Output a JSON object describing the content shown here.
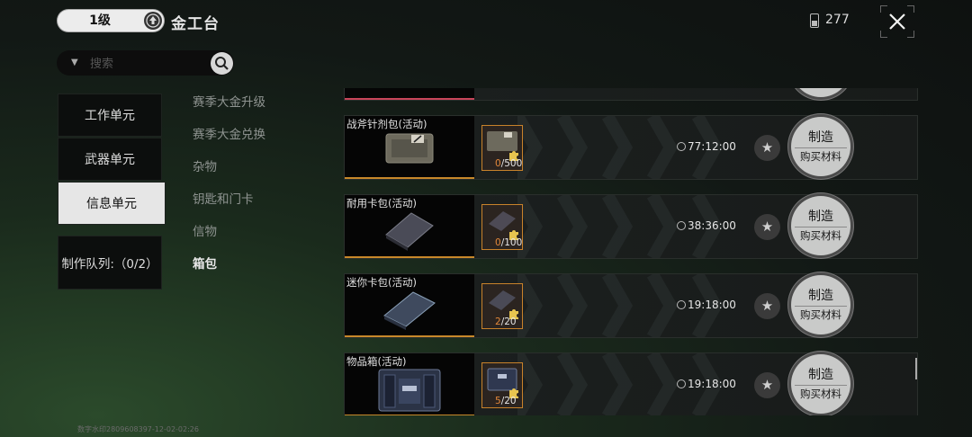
{
  "header": {
    "level": "1级",
    "title": "金工台",
    "currency_amount": "277"
  },
  "search": {
    "placeholder": "搜索"
  },
  "sidebar": {
    "items": [
      {
        "label": "工作单元",
        "active": false
      },
      {
        "label": "武器单元",
        "active": false
      },
      {
        "label": "信息单元",
        "active": true
      }
    ],
    "queue_label": "制作队列:（0/2）"
  },
  "categories": [
    {
      "label": "赛季大金升级",
      "active": false
    },
    {
      "label": "赛季大金兑换",
      "active": false
    },
    {
      "label": "杂物",
      "active": false
    },
    {
      "label": "钥匙和门卡",
      "active": false
    },
    {
      "label": "信物",
      "active": false
    },
    {
      "label": "箱包",
      "active": true
    }
  ],
  "recipes": [
    {
      "name": "战斧针剂包(活动)",
      "owned": "0",
      "required": "/500",
      "time": "77:12:00",
      "craft_label": "制造",
      "buy_label": "购买材料",
      "item_icon": "injector-pack-icon"
    },
    {
      "name": "耐用卡包(活动)",
      "owned": "0",
      "required": "/100",
      "time": "38:36:00",
      "craft_label": "制造",
      "buy_label": "购买材料",
      "item_icon": "card-case-icon"
    },
    {
      "name": "迷你卡包(活动)",
      "owned": "2",
      "required": "/20",
      "time": "19:18:00",
      "craft_label": "制造",
      "buy_label": "购买材料",
      "item_icon": "mini-card-case-icon"
    },
    {
      "name": "物品箱(活动)",
      "owned": "5",
      "required": "/20",
      "time": "19:18:00",
      "craft_label": "制造",
      "buy_label": "购买材料",
      "item_icon": "item-box-icon"
    }
  ],
  "watermark": "数字水印2809608397-12-02-02:26",
  "colors": {
    "accent_orange": "#c8882a",
    "owned_count": "#e2873a",
    "craft_button": "#c9cac9"
  }
}
